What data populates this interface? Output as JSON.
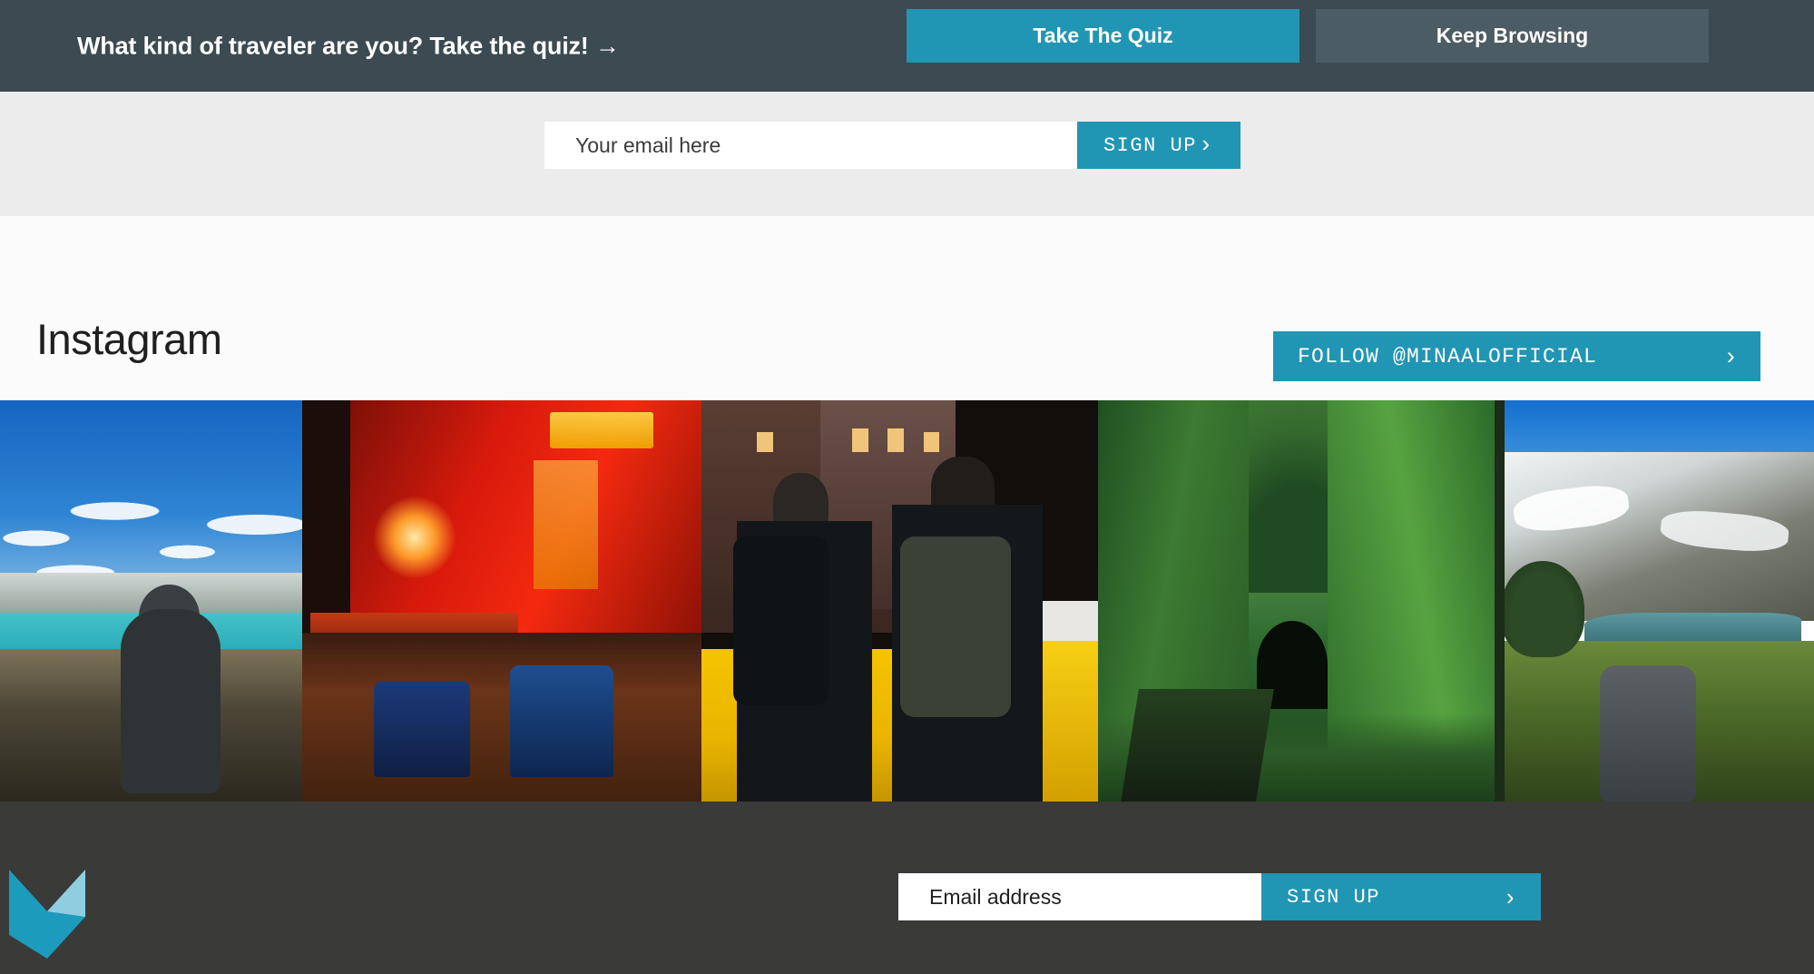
{
  "quiz_banner": {
    "prompt": "What kind of traveler are you? Take the quiz! →",
    "primary_button": "Take The Quiz",
    "secondary_button": "Keep Browsing",
    "background_color": "#3c4a52",
    "primary_color": "#2195b4",
    "secondary_color": "#4c5c64"
  },
  "top_signup": {
    "email_placeholder": "Your email here",
    "email_value": "",
    "button_label": "SIGN UP",
    "button_chevron": "›",
    "strip_background": "#ececec",
    "button_color": "#2195b4"
  },
  "instagram": {
    "heading": "Instagram",
    "follow_button_label": "FOLLOW @MINAALOFFICIAL",
    "follow_button_chevron": "›",
    "follow_button_color": "#2195b4",
    "photos": [
      {
        "alt": "Backpacker seated on rocky ridge overlooking turquoise alpine lake under blue sky"
      },
      {
        "alt": "Neon-lit red signage over a wet night street with tuk-tuks in Bangkok"
      },
      {
        "alt": "Two travellers with backpacks holding hands beside a yellow taxi at night"
      },
      {
        "alt": "Disused railway track running into a tunnel of vine-covered green walls"
      },
      {
        "alt": "Grey backpack resting on scrub grass before a snow-streaked mountain lake"
      }
    ]
  },
  "footer": {
    "logo_name": "minaal-logo",
    "logo_color_dark": "#1d9bbd",
    "logo_color_light": "#8fcde0",
    "email_placeholder": "Email address",
    "email_value": "",
    "button_label": "SIGN UP",
    "button_chevron": "›",
    "background_color": "#3a3a38",
    "button_color": "#2195b4"
  }
}
